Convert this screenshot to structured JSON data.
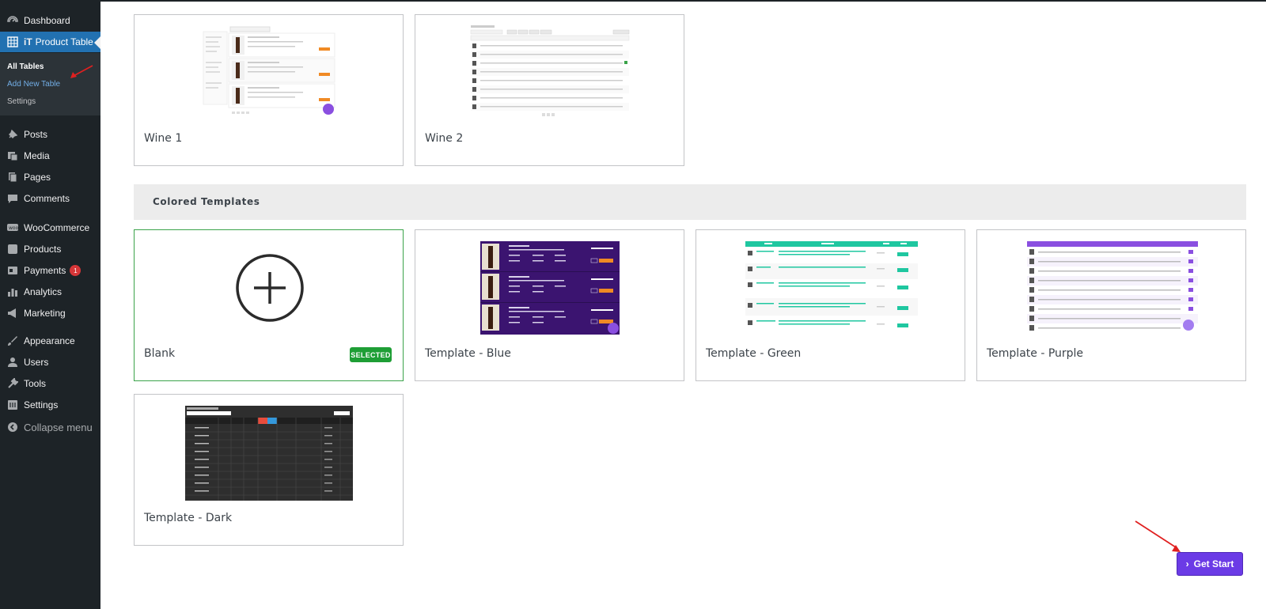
{
  "sidebar": {
    "items": [
      {
        "label": "Dashboard",
        "icon": "dashboard-icon"
      },
      {
        "label": "Product Table",
        "icon": "table-icon",
        "prefix": "iT"
      },
      {
        "label": "Posts",
        "icon": "pin-icon"
      },
      {
        "label": "Media",
        "icon": "media-icon"
      },
      {
        "label": "Pages",
        "icon": "pages-icon"
      },
      {
        "label": "Comments",
        "icon": "comment-icon"
      },
      {
        "label": "WooCommerce",
        "icon": "woo-icon"
      },
      {
        "label": "Products",
        "icon": "products-icon"
      },
      {
        "label": "Payments",
        "icon": "payments-icon",
        "badge": "1"
      },
      {
        "label": "Analytics",
        "icon": "analytics-icon"
      },
      {
        "label": "Marketing",
        "icon": "marketing-icon"
      },
      {
        "label": "Appearance",
        "icon": "brush-icon"
      },
      {
        "label": "Users",
        "icon": "users-icon"
      },
      {
        "label": "Tools",
        "icon": "tools-icon"
      },
      {
        "label": "Settings",
        "icon": "settings-icon"
      }
    ],
    "submenu": {
      "all_tables": "All Tables",
      "add_new": "Add New Table",
      "settings": "Settings"
    },
    "collapse": "Collapse menu"
  },
  "main": {
    "templates_top": [
      {
        "title": "Wine 1"
      },
      {
        "title": "Wine 2"
      }
    ],
    "section_title": "Colored Templates",
    "templates_colored": [
      {
        "title": "Blank",
        "badge": "SELECTED"
      },
      {
        "title": "Template - Blue"
      },
      {
        "title": "Template - Green"
      },
      {
        "title": "Template - Purple"
      },
      {
        "title": "Template - Dark"
      }
    ],
    "get_start": "Get Start"
  },
  "colors": {
    "sidebar_bg": "#1d2327",
    "accent_blue": "#2271b1",
    "selected_green": "#1e9e35",
    "button_purple": "#6b3be6",
    "blue_template": "#3b1470",
    "green_template": "#1fc7a0",
    "purple_template": "#8a4fe0",
    "dark_template": "#2e2e2e",
    "annotation_red": "#e02020"
  }
}
